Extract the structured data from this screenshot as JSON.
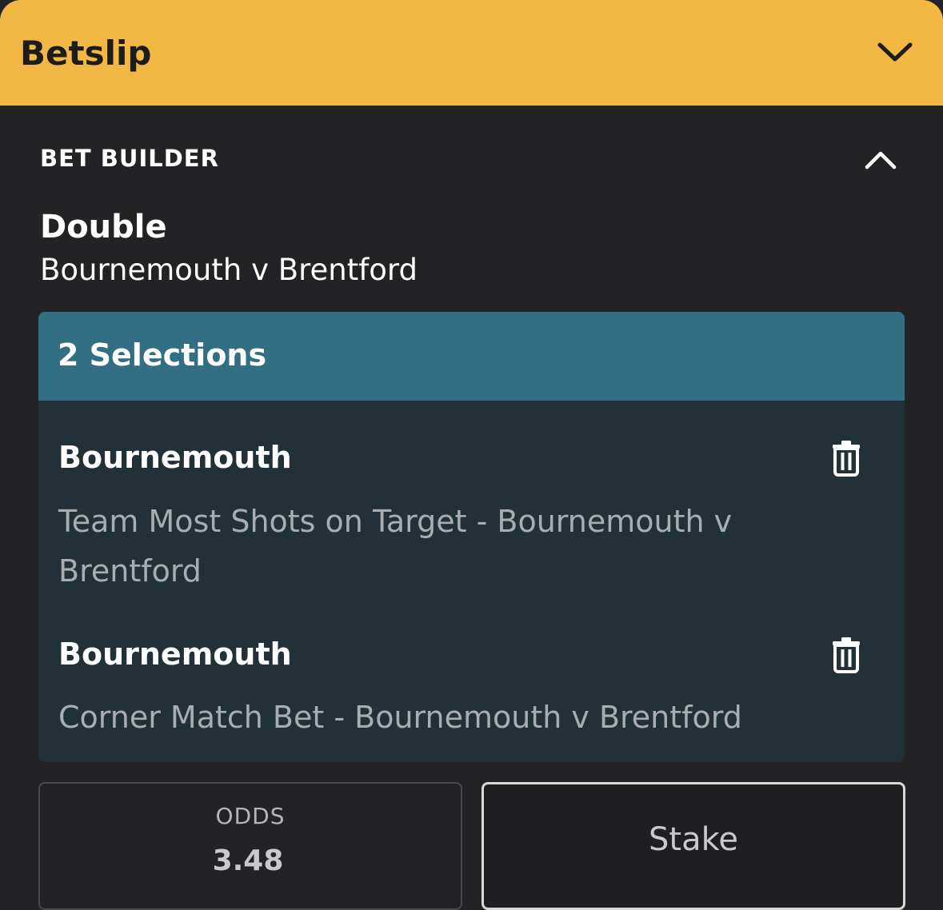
{
  "header": {
    "title": "Betslip",
    "collapse_icon": "chevron-down-icon",
    "background": "#f2b843"
  },
  "bet_builder": {
    "label": "BET BUILDER",
    "toggle_icon": "chevron-up-icon",
    "bet_type": "Double",
    "event": "Bournemouth v Brentford",
    "selections_header": "2 Selections",
    "header_color": "#336f82",
    "selections": [
      {
        "title": "Bournemouth",
        "market_line1": "Team Most Shots on Target - Bournemouth v",
        "market_line2": "Brentford",
        "remove_icon": "trash-icon"
      },
      {
        "title": "Bournemouth",
        "market_line1": "Corner Match Bet - Bournemouth v Brentford",
        "remove_icon": "trash-icon"
      }
    ]
  },
  "odds": {
    "label": "ODDS",
    "value": "3.48"
  },
  "stake": {
    "placeholder": "Stake"
  }
}
